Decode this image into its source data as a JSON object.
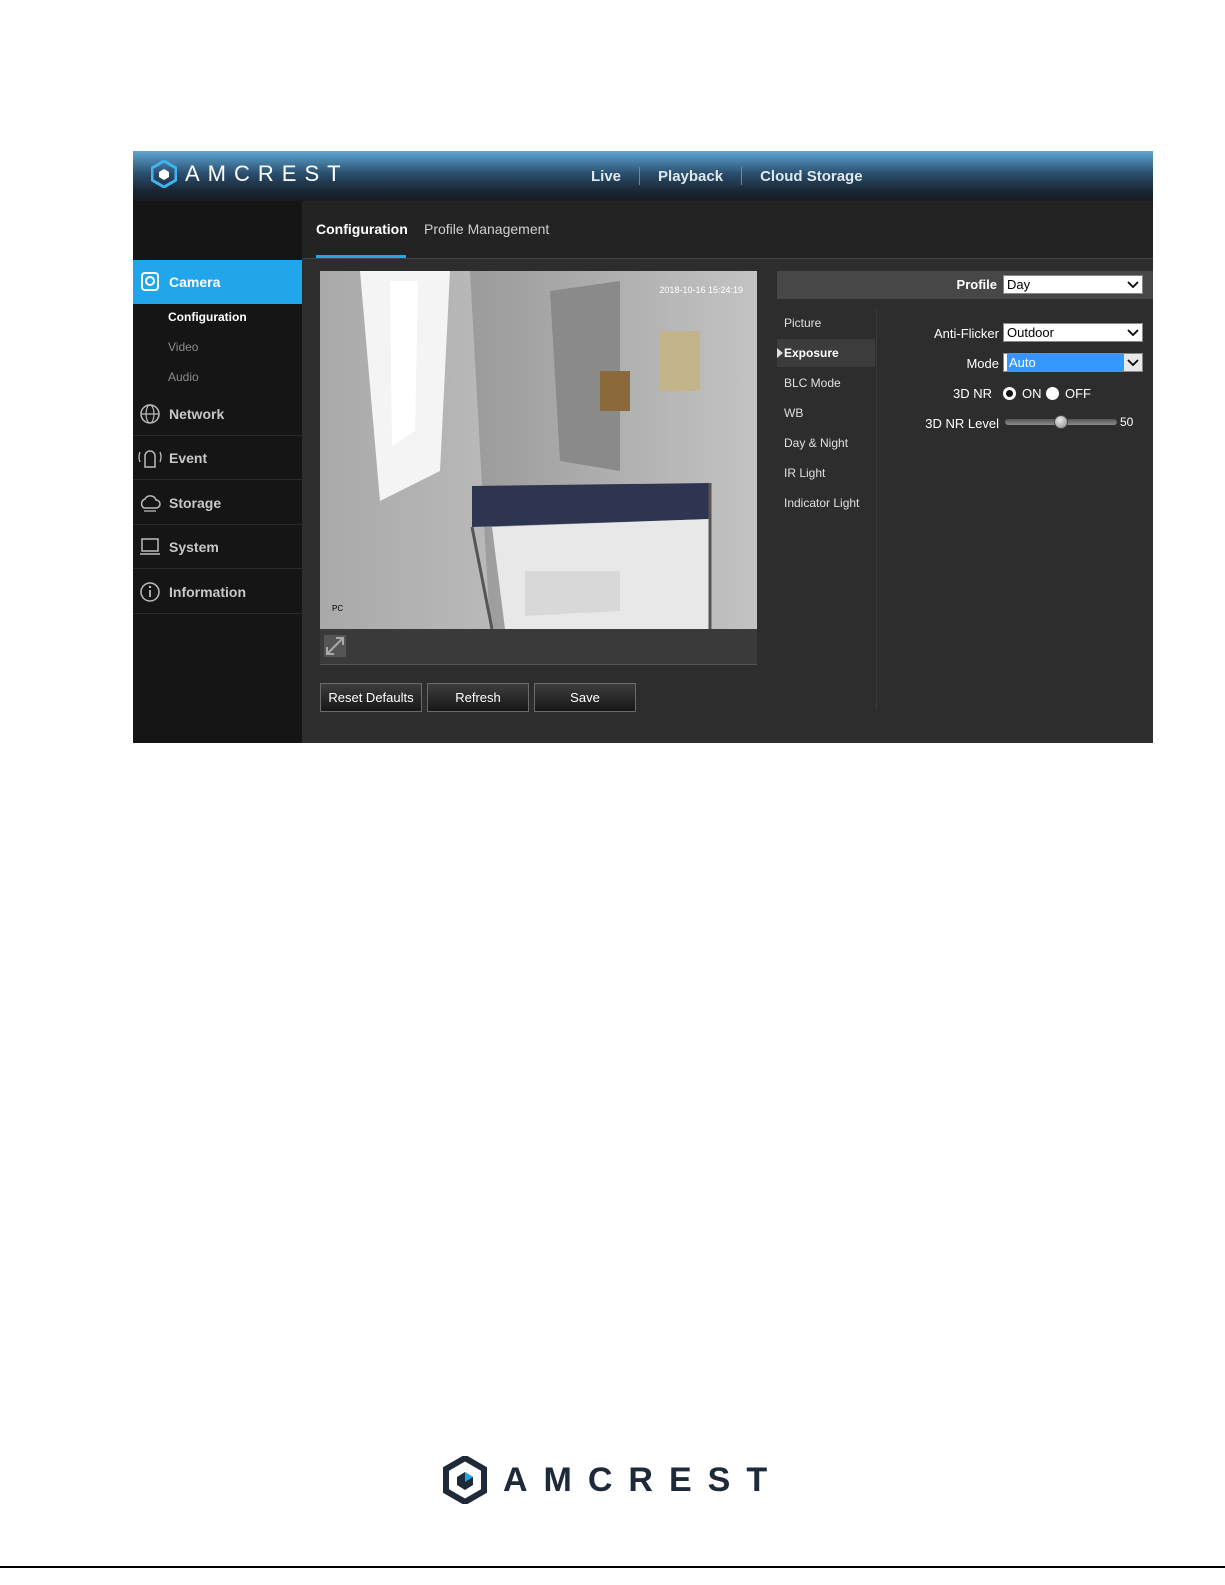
{
  "brand": {
    "logo_text": "AMCREST"
  },
  "top_nav": {
    "items": [
      "Live",
      "Playback",
      "Cloud Storage"
    ]
  },
  "sidebar": {
    "main_items": [
      {
        "label": "Camera",
        "icon": "camera-icon",
        "active": true
      },
      {
        "label": "Network",
        "icon": "network-icon"
      },
      {
        "label": "Event",
        "icon": "event-alarm-icon"
      },
      {
        "label": "Storage",
        "icon": "storage-cloud-icon"
      },
      {
        "label": "System",
        "icon": "system-monitor-icon"
      },
      {
        "label": "Information",
        "icon": "information-icon"
      }
    ],
    "camera_sub_items": [
      {
        "label": "Configuration",
        "active": true
      },
      {
        "label": "Video"
      },
      {
        "label": "Audio"
      }
    ]
  },
  "subtabs": [
    {
      "label": "Configuration",
      "active": true
    },
    {
      "label": "Profile Management"
    }
  ],
  "video": {
    "timestamp": "2018-10-16 15:24:19",
    "channel_label": "PC"
  },
  "buttons": {
    "reset": "Reset Defaults",
    "refresh": "Refresh",
    "save": "Save"
  },
  "settings": {
    "profile_label": "Profile",
    "profile_value": "Day",
    "categories": [
      "Picture",
      "Exposure",
      "BLC Mode",
      "WB",
      "Day & Night",
      "IR Light",
      "Indicator Light"
    ],
    "active_category": "Exposure",
    "anti_flicker_label": "Anti-Flicker",
    "anti_flicker_value": "Outdoor",
    "mode_label": "Mode",
    "mode_value": "Auto",
    "nr_label": "3D NR",
    "nr_on_label": "ON",
    "nr_off_label": "OFF",
    "nr_selected": "ON",
    "nr_level_label": "3D NR Level",
    "nr_level_value": "50",
    "nr_level_fraction": 0.5
  },
  "colors": {
    "accent": "#21a6eb",
    "sidebar_bg": "#151515",
    "panel_bg": "#2d2d2d"
  }
}
